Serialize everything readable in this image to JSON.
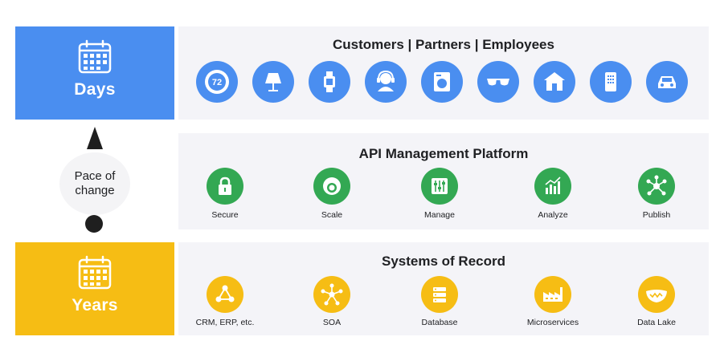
{
  "left": {
    "days_label": "Days",
    "years_label": "Years",
    "pace_line1": "Pace of",
    "pace_line2": "change"
  },
  "top_panel": {
    "title": "Customers | Partners | Employees",
    "thermostat_value": "72",
    "icons": [
      "thermostat-icon",
      "lamp-icon",
      "watch-icon",
      "headset-icon",
      "washer-icon",
      "sunglasses-icon",
      "house-icon",
      "tablet-icon",
      "car-icon"
    ]
  },
  "mid_panel": {
    "title": "API Management Platform",
    "items": [
      {
        "label": "Secure",
        "icon": "lock-icon"
      },
      {
        "label": "Scale",
        "icon": "scale-icon"
      },
      {
        "label": "Manage",
        "icon": "sliders-icon"
      },
      {
        "label": "Analyze",
        "icon": "bar-chart-icon"
      },
      {
        "label": "Publish",
        "icon": "network-icon"
      }
    ]
  },
  "bot_panel": {
    "title": "Systems of Record",
    "items": [
      {
        "label": "CRM, ERP, etc.",
        "icon": "nodes-icon"
      },
      {
        "label": "SOA",
        "icon": "hub-icon"
      },
      {
        "label": "Database",
        "icon": "database-icon"
      },
      {
        "label": "Microservices",
        "icon": "factory-icon"
      },
      {
        "label": "Data Lake",
        "icon": "lake-icon"
      }
    ]
  },
  "colors": {
    "blue": "#4a8ef0",
    "yellow": "#f6bd14",
    "green": "#33a853",
    "panel_bg": "#f4f4f8"
  }
}
